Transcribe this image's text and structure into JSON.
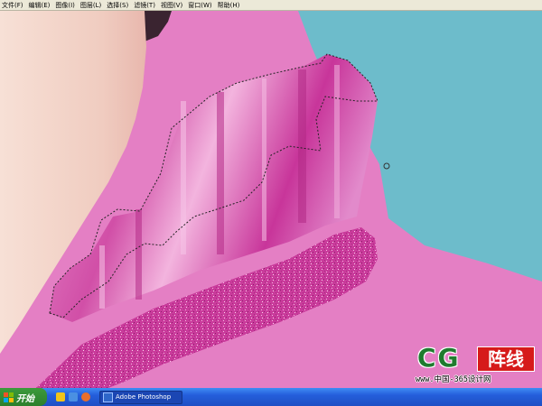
{
  "menubar": {
    "items": [
      "文件(F)",
      "编辑(E)",
      "图像(I)",
      "图层(L)",
      "选择(S)",
      "滤镜(T)",
      "视图(V)",
      "窗口(W)",
      "帮助(H)"
    ]
  },
  "canvas": {
    "colors": {
      "background_teal": "#6dbccb",
      "pink_background": "#e47fc4",
      "skin": "#f4d6cc",
      "ruffle": "#d653a8",
      "ruffle_light": "#ee9ad2",
      "collar_band": "#c8389a"
    }
  },
  "watermark": {
    "logo_cg": "CG",
    "logo_cn": "阵线",
    "line": "www.中国-365设计网"
  },
  "taskbar": {
    "start_label": "开始",
    "app_label": "Adobe Photoshop"
  }
}
